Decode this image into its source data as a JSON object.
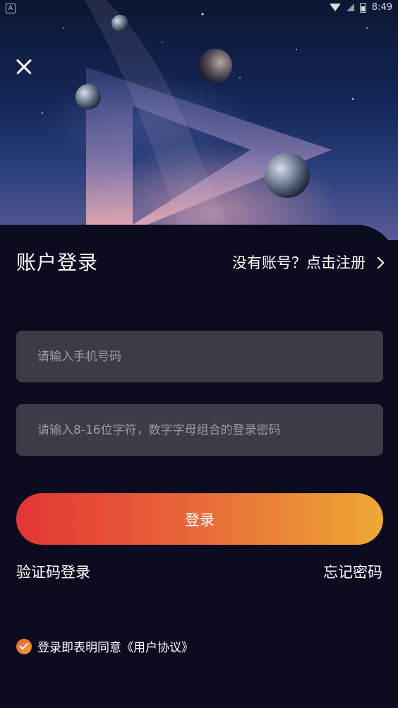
{
  "status_bar": {
    "left_badge": "A",
    "time": "8:49"
  },
  "header": {
    "close_icon": "close-icon",
    "title": "账户登录",
    "register_prompt": "没有账号？点击注册"
  },
  "form": {
    "phone_placeholder": "请输入手机号码",
    "password_placeholder": "请输入8-16位字符，数字字母组合的登录密码",
    "login_label": "登录"
  },
  "links": {
    "sms_login": "验证码登录",
    "forgot_password": "忘记密码"
  },
  "agreement": {
    "checked": true,
    "prefix": "登录即表明同意",
    "link": "《用户协议》"
  },
  "colors": {
    "background": "#0b0c1f",
    "field": "#3c3c49",
    "accent_start": "#e43535",
    "accent_end": "#eea935"
  }
}
